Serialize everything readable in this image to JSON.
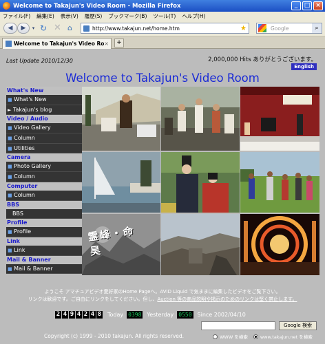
{
  "window": {
    "title": "Welcome to Takajun's Video Room - Mozilla Firefox"
  },
  "menu": [
    "ファイル(F)",
    "編集(E)",
    "表示(V)",
    "履歴(S)",
    "ブックマーク(B)",
    "ツール(T)",
    "ヘルプ(H)"
  ],
  "nav": {
    "url": "http://www.takajun.net/home.htm",
    "search_placeholder": "Google"
  },
  "tab": {
    "label": "Welcome to Takajun's Video Room"
  },
  "header": {
    "last_update": "Last Update 2010/12/30",
    "hits": "2,000,000 Hits ありがとうございます。",
    "english": "English",
    "welcome": "Welcome to Takajun's Video Room"
  },
  "sidebar": {
    "sections": [
      {
        "heading": "What's New",
        "items": [
          {
            "label": "What's New",
            "mark": "■"
          },
          {
            "label": "Takajun's blog",
            "mark": "►"
          }
        ]
      },
      {
        "heading": "Video / Audio",
        "items": [
          {
            "label": "Video Gallery",
            "mark": "■"
          },
          {
            "label": "Column",
            "mark": "■"
          },
          {
            "label": "Utilities",
            "mark": "■"
          }
        ]
      },
      {
        "heading": "Camera",
        "items": [
          {
            "label": "Photo Gallery",
            "mark": "■"
          },
          {
            "label": "Column",
            "mark": "■"
          }
        ]
      },
      {
        "heading": "Computer",
        "items": [
          {
            "label": "Column",
            "mark": "■"
          }
        ]
      },
      {
        "heading": "BBS",
        "items": [
          {
            "label": "BBS",
            "mark": ""
          }
        ]
      },
      {
        "heading": "Profile",
        "items": [
          {
            "label": "Profile",
            "mark": "■"
          }
        ]
      },
      {
        "heading": "Link",
        "items": [
          {
            "label": "Link",
            "mark": "■"
          }
        ]
      },
      {
        "heading": "Mail & Banner",
        "items": [
          {
            "label": "Mail & Banner",
            "mark": "■"
          }
        ]
      }
    ]
  },
  "gallery": {
    "photo_caption_kanji": "霊峰・命昊"
  },
  "intro": {
    "line1": "ようこそ アマチュアビデオ愛好家のHome Pageへ。AVID Liquid で気ままに編集したビデオをご覧下さい。",
    "line2_pre": "リンクは歓迎です。ご自由にリンクをしてください。但し、",
    "line2_link": "Auction 等の商品説明や掲示のためのリンクは堅く禁止します。"
  },
  "stats": {
    "total_counter": "2494248",
    "today_label": "Today",
    "today_value": "0398",
    "yesterday_label": "Yesterday",
    "yesterday_value": "0550",
    "since": "Since 2002/04/10"
  },
  "google_search": {
    "button": "Google 検索",
    "radio_web": "WWW を検索",
    "radio_site": "www.takajun.net を検索"
  },
  "footer": {
    "copyright": "Copyright (c) 1999 - 2010 takajun. All rights reserved."
  }
}
